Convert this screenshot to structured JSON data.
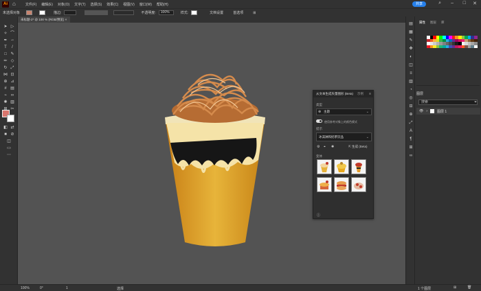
{
  "menubar": {
    "logo": "Ai",
    "items": [
      "文件(F)",
      "编辑(E)",
      "对象(O)",
      "文字(T)",
      "选择(S)",
      "效果(C)",
      "视图(V)",
      "窗口(W)",
      "帮助(H)"
    ],
    "share_label": "共享"
  },
  "control": {
    "selection_label": "未选择对象",
    "stroke_label": "描边:",
    "opacity_value": "100%",
    "style_label": "样式:",
    "doc_setup": "文档设置",
    "prefs": "首选项"
  },
  "doc_tab": {
    "title": "未标题-2* @ 100 % (RGB/预览)"
  },
  "generate_panel": {
    "title": "从文本生成矢量图形 (Beta)",
    "tab2": "示例",
    "type_label": "类型",
    "type_value": "主题",
    "toggle_label": "使用参考对象上的颜色模式",
    "prompt_label": "提示",
    "prompt_value": "冰淇淋和奶茶饮品",
    "generate_label": "生成 (Beta)",
    "variations_label": "变体"
  },
  "layers": {
    "tabs": [
      "属性",
      "图层",
      "库"
    ],
    "search_placeholder": "搜索",
    "layer_name": "图层 1",
    "count": "1 个图层"
  },
  "status": {
    "zoom": "100%",
    "rotate": "0°",
    "page": "1",
    "tool": "选择"
  },
  "colors": {
    "accent": "#2680eb",
    "cup_yellow": "#e3a424",
    "noodle": "#d58b4c"
  }
}
